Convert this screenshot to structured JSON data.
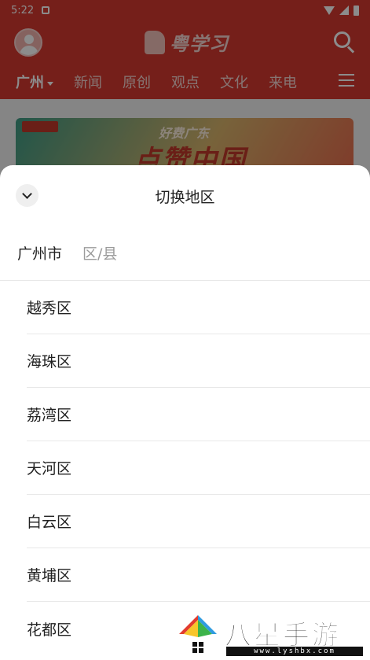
{
  "status_bar": {
    "time": "5:22",
    "icons": [
      "app-notification-icon",
      "wifi-icon",
      "signal-icon",
      "battery-icon"
    ]
  },
  "app_header": {
    "logo_text": "粤学习",
    "icons": [
      "avatar",
      "search-icon",
      "menu-icon"
    ],
    "tabs": [
      {
        "label": "广州",
        "active": true
      },
      {
        "label": "新闻"
      },
      {
        "label": "原创"
      },
      {
        "label": "观点"
      },
      {
        "label": "文化"
      },
      {
        "label": "来电"
      }
    ]
  },
  "banner": {
    "title": "好费广东",
    "big_text": "点赞中国"
  },
  "sheet": {
    "title": "切换地区",
    "selected_city": "广州市",
    "district_placeholder": "区/县",
    "districts": [
      "越秀区",
      "海珠区",
      "荔湾区",
      "天河区",
      "白云区",
      "黄埔区",
      "花都区"
    ]
  },
  "watermark": {
    "text": "八星手游网",
    "url": "www.lyshbx.com"
  },
  "colors": {
    "brand_red": "#d63a31",
    "tab_indicator": "#f5b041",
    "sheet_bg": "#ffffff",
    "muted_text": "#9a9a9a"
  }
}
